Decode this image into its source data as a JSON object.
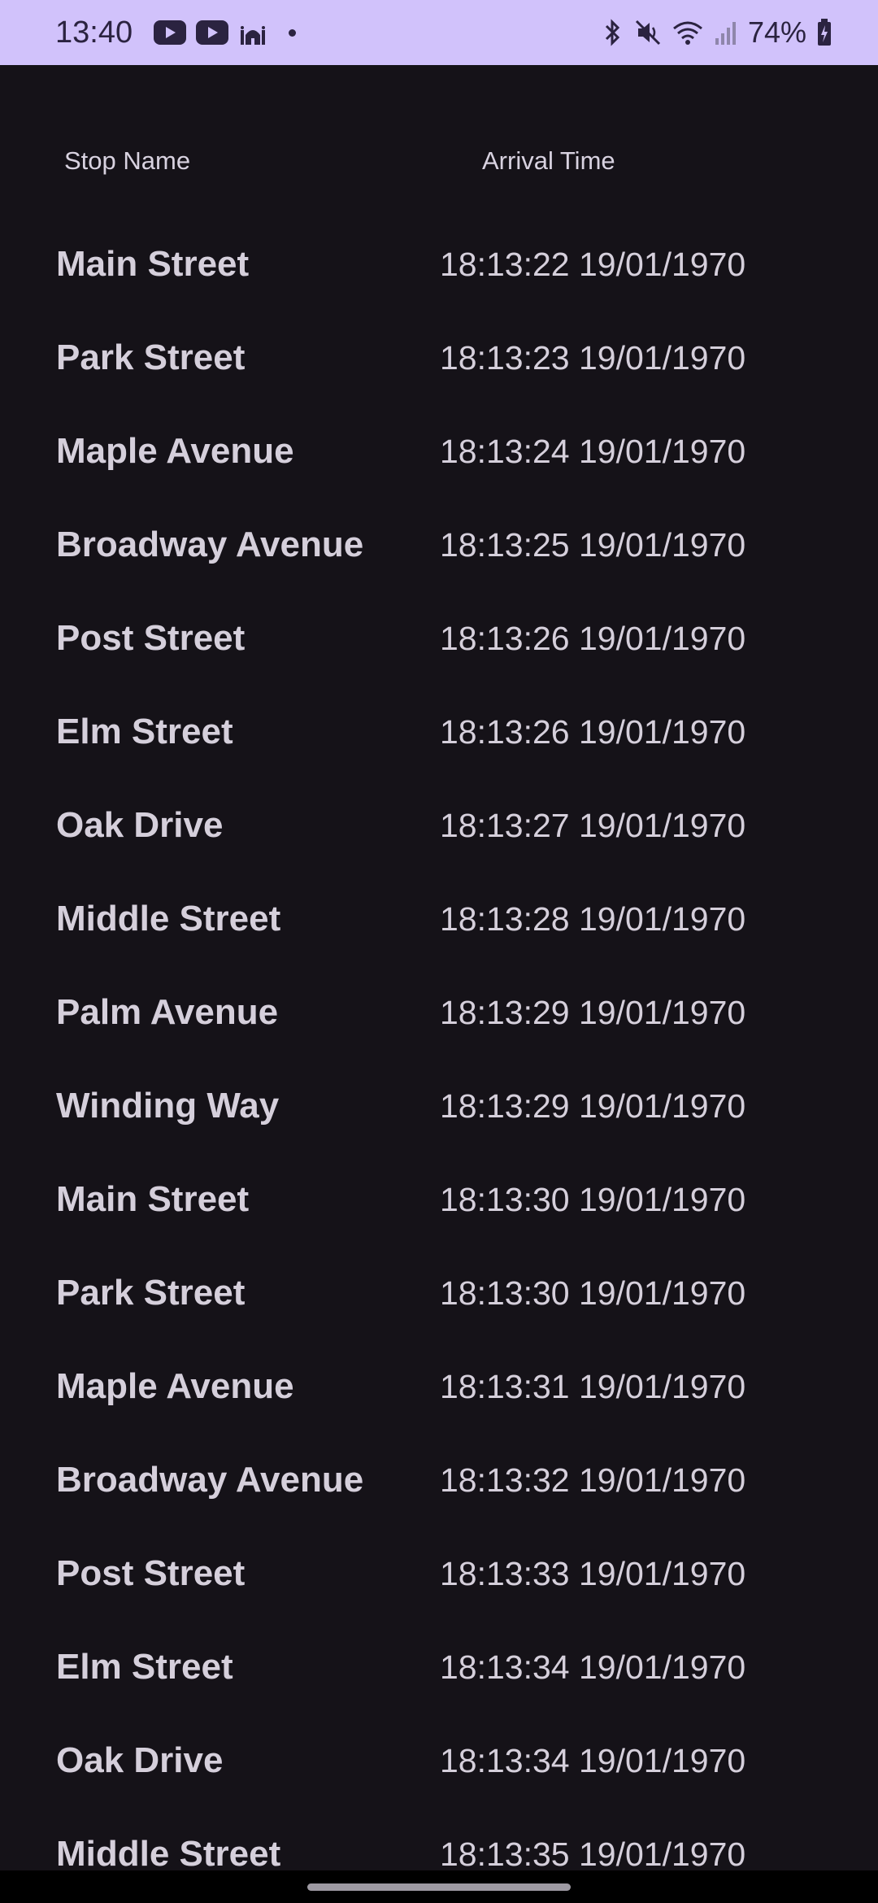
{
  "status_bar": {
    "time": "13:40",
    "battery": "74%",
    "icons_left": [
      "youtube-icon",
      "youtube-icon",
      "mosque-icon",
      "dot-icon"
    ],
    "icons_right": [
      "bluetooth-icon",
      "mute-icon",
      "wifi-icon",
      "signal-icon",
      "battery-charging-icon"
    ]
  },
  "table": {
    "header": {
      "stop_name": "Stop Name",
      "arrival_time": "Arrival Time"
    },
    "rows": [
      {
        "stop": "Main Street",
        "time": "18:13:22 19/01/1970"
      },
      {
        "stop": "Park Street",
        "time": "18:13:23 19/01/1970"
      },
      {
        "stop": "Maple Avenue",
        "time": "18:13:24 19/01/1970"
      },
      {
        "stop": "Broadway Avenue",
        "time": "18:13:25 19/01/1970"
      },
      {
        "stop": "Post Street",
        "time": "18:13:26 19/01/1970"
      },
      {
        "stop": "Elm Street",
        "time": "18:13:26 19/01/1970"
      },
      {
        "stop": "Oak Drive",
        "time": "18:13:27 19/01/1970"
      },
      {
        "stop": "Middle Street",
        "time": "18:13:28 19/01/1970"
      },
      {
        "stop": "Palm Avenue",
        "time": "18:13:29 19/01/1970"
      },
      {
        "stop": "Winding Way",
        "time": "18:13:29 19/01/1970"
      },
      {
        "stop": "Main Street",
        "time": "18:13:30 19/01/1970"
      },
      {
        "stop": "Park Street",
        "time": "18:13:30 19/01/1970"
      },
      {
        "stop": "Maple Avenue",
        "time": "18:13:31 19/01/1970"
      },
      {
        "stop": "Broadway Avenue",
        "time": "18:13:32 19/01/1970"
      },
      {
        "stop": "Post Street",
        "time": "18:13:33 19/01/1970"
      },
      {
        "stop": "Elm Street",
        "time": "18:13:34 19/01/1970"
      },
      {
        "stop": "Oak Drive",
        "time": "18:13:34 19/01/1970"
      },
      {
        "stop": "Middle Street",
        "time": "18:13:35 19/01/1970"
      }
    ]
  },
  "colors": {
    "status_bar_bg": "#d1c2fb",
    "background": "#151218",
    "text": "#d5cfdb"
  }
}
